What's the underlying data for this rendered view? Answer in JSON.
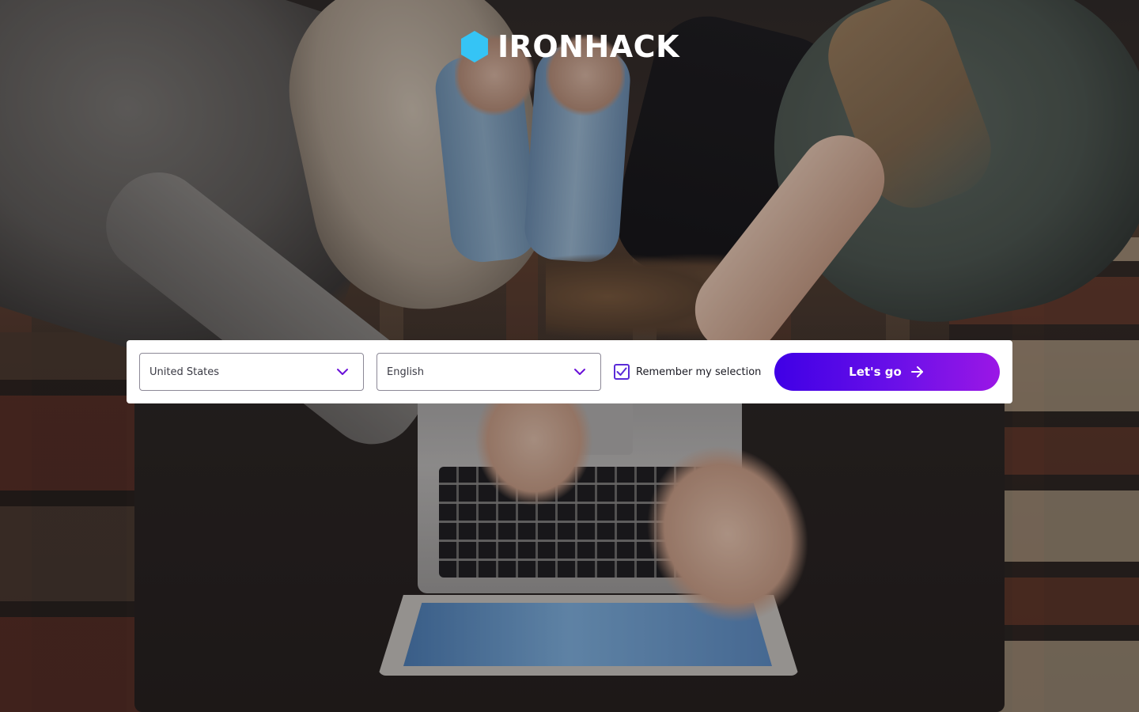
{
  "brand": {
    "name": "IRONHACK",
    "logo_icon": "hexagon-icon",
    "logo_color": "#35C4F5"
  },
  "selector": {
    "country": {
      "value": "United States",
      "icon": "chevron-down-icon"
    },
    "language": {
      "value": "English",
      "icon": "chevron-down-icon"
    },
    "remember": {
      "label": "Remember my selection",
      "checked": true,
      "icon": "checkmark-icon"
    },
    "submit": {
      "label": "Let's go",
      "icon": "arrow-right-icon"
    }
  },
  "colors": {
    "accent_start": "#3F00E6",
    "accent_end": "#9B17E6",
    "chevron": "#6A10D8",
    "panel_bg": "#FFFFFF"
  }
}
